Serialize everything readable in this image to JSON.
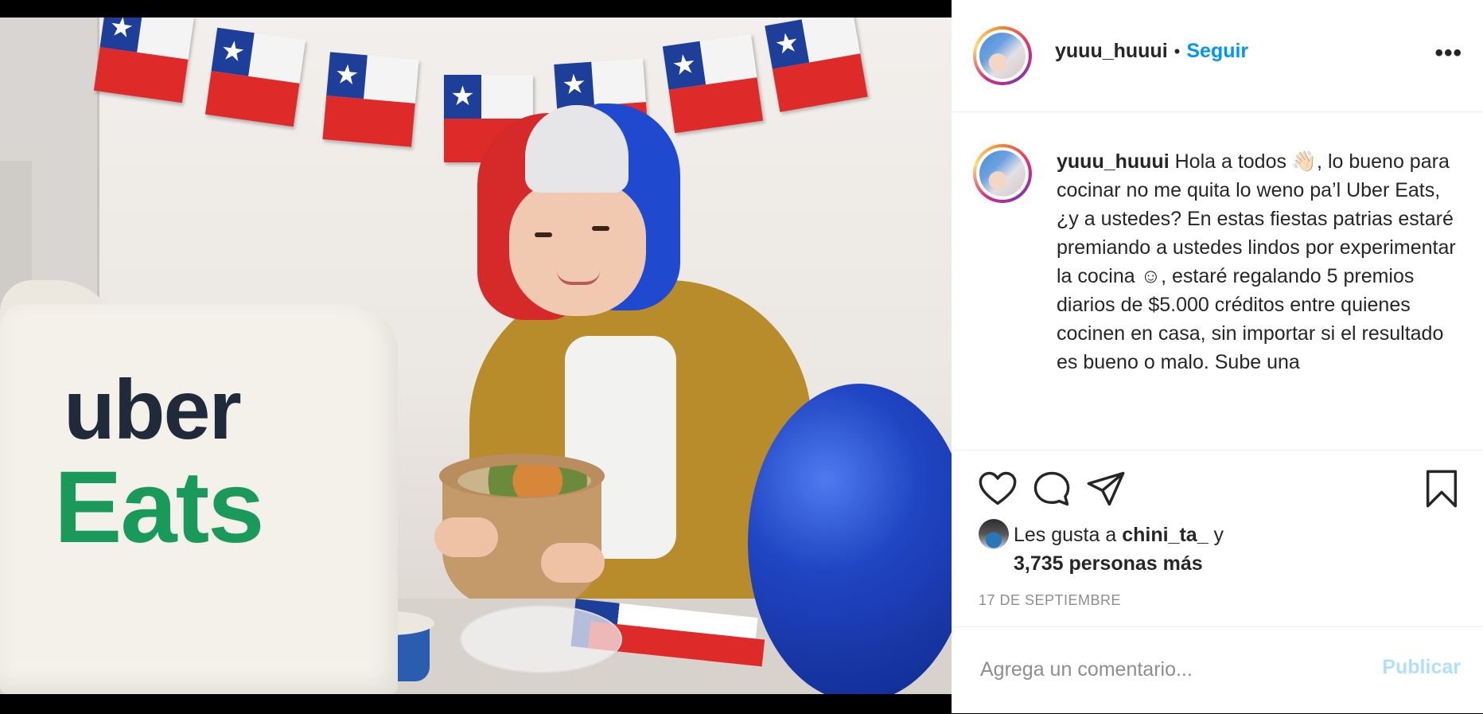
{
  "post": {
    "username": "yuuu_huuui",
    "separator": "•",
    "follow_label": "Seguir",
    "more_label": "•••",
    "photo_alt": "Foto de la publicación",
    "photo_text": {
      "uber": "Uber",
      "eats": "Eats"
    }
  },
  "caption": {
    "username": "yuuu_huuui",
    "text": "Hola a todos 👋🏻, lo bueno para cocinar no me quita lo weno pa’l Uber Eats, ¿y a ustedes? En estas fiestas patrias estaré premiando a ustedes lindos por experimentar la cocina ☺, estaré regalando 5 premios diarios de $5.000 créditos entre quienes cocinen en casa, sin importar si el resultado es bueno o malo. Sube una"
  },
  "actions": {
    "like_icon": "heart-icon",
    "comment_icon": "comment-icon",
    "share_icon": "share-icon",
    "save_icon": "bookmark-icon"
  },
  "likes": {
    "prefix": "Les gusta a",
    "user": "chini_ta_",
    "connector": "y",
    "count_text": "3,735 personas más"
  },
  "date": "17 DE SEPTIEMBRE",
  "comment": {
    "placeholder": "Agrega un comentario...",
    "publish_label": "Publicar"
  },
  "colors": {
    "accent": "#0095f6",
    "publish_disabled": "#b2dffc",
    "muted": "#8e8e8e",
    "text": "#262626"
  }
}
